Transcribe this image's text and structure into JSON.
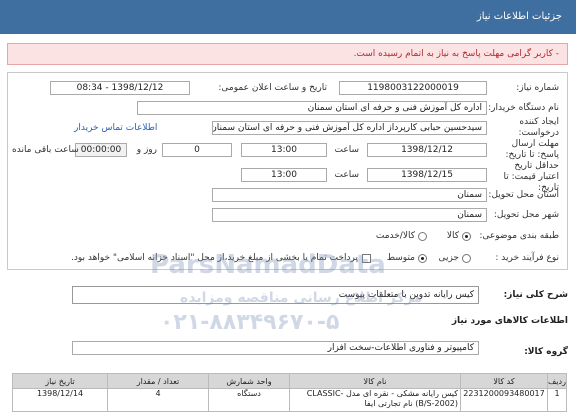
{
  "header": {
    "title": "جزئیات اطلاعات نیاز"
  },
  "alert": {
    "text": "- کاربر گرامی مهلت پاسخ به نیاز به اتمام رسیده است."
  },
  "form": {
    "need_number_label": "شماره نیاز:",
    "need_number": "1198003122000019",
    "announce_label": "تاریخ و ساعت اعلان عمومی:",
    "announce_value": "1398/12/12 - 08:34",
    "buyer_label": "نام دستگاه خریدار:",
    "buyer_value": "اداره کل آموزش فنی و حرفه ای استان سمنان",
    "creator_label": "ایجاد کننده درخواست:",
    "creator_value": "سیدحسین حبابی کارپرداز اداره کل آموزش فنی و حرفه ای استان سمنان",
    "contact_link": "اطلاعات تماس خریدار",
    "deadline_label": "مهلت ارسال پاسخ: تا تاریخ:",
    "deadline_date": "1398/12/12",
    "time_label": "ساعت",
    "deadline_time": "13:00",
    "days_value": "0",
    "days_label": "روز و",
    "remaining_time": "00:00:00",
    "remaining_label": "ساعت باقی مانده",
    "validity_label": "حداقل تاریخ اعتبار قیمت: تا تاریخ:",
    "validity_date": "1398/12/15",
    "validity_time_label": "ساعت",
    "validity_time": "13:00",
    "province_label": "استان محل تحویل:",
    "province_value": "سمنان",
    "city_label": "شهر محل تحویل:",
    "city_value": "سمنان",
    "category_label": "طبقه بندی موضوعی:",
    "category_options": [
      "کالا",
      "کالا/خدمت"
    ],
    "purchase_label": "نوع فرآیند خرید :",
    "purchase_options": [
      "جزیی",
      "متوسط"
    ],
    "payment_text": "پرداخت تمام یا بخشی از مبلغ خرید،از محل \"اسناد خزانه اسلامی\" خواهد بود."
  },
  "description": {
    "label": "شرح کلی نیاز:",
    "value": "کیس رایانه تدوین با متعلقات پیوست"
  },
  "goods": {
    "section_title": "اطلاعات کالاهای مورد نیاز",
    "group_label": "گروه کالا:",
    "group_value": "کامپیوتر و فناوری اطلاعات-سخت افزار",
    "columns": [
      "ردیف",
      "کد کالا",
      "نام کالا",
      "واحد شمارش",
      "تعداد / مقدار",
      "تاریخ نیاز"
    ],
    "rows": [
      {
        "row": "1",
        "code": "2231200093480017",
        "name": "کیس رایانه مشکی - نقره ای مدل CLASSIC-(B/S-2002) نام تجارتی ایفا",
        "unit": "دستگاه",
        "qty": "4",
        "date": "1398/12/14"
      }
    ]
  },
  "watermark": {
    "line1": "ParsNamadData",
    "line2": "مرکز اطلاع رسانی مناقصه ومزایده",
    "line3": "۰۲۱-۸۸۳۴۹۶۷۰-۵"
  },
  "colors": {
    "header_bg": "#3f6fa0",
    "alert_bg": "#fbe3e4",
    "alert_text": "#b02a2f",
    "link": "#2a5fb0"
  }
}
